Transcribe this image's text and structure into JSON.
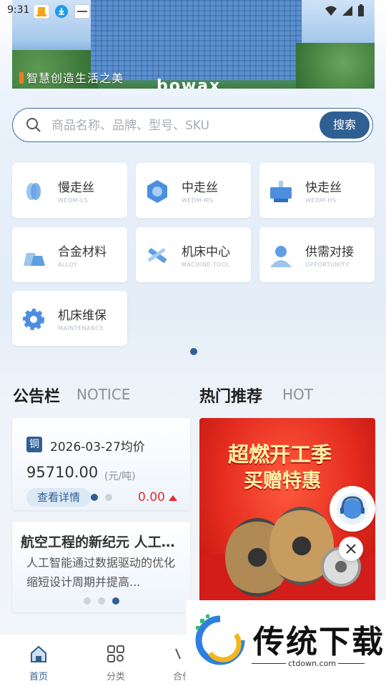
{
  "status_bar": {
    "time": "9:31",
    "app_icons": [
      "bowax-app-icon",
      "download-icon",
      "news-app-icon"
    ],
    "system_icons": [
      "wifi-icon",
      "signal-icon",
      "battery-icon"
    ]
  },
  "banner": {
    "slogan": "智慧创造生活之美",
    "logo_text": "bowax"
  },
  "search": {
    "placeholder": "商品名称、品牌、型号、SKU",
    "value": "",
    "button_label": "搜索"
  },
  "categories": [
    {
      "title": "慢走丝",
      "subtitle": "WEDM-LS",
      "icon": "wire-spool-icon"
    },
    {
      "title": "中走丝",
      "subtitle": "WEDM-MS",
      "icon": "hexagon-nut-icon"
    },
    {
      "title": "快走丝",
      "subtitle": "WEDM-HS",
      "icon": "machine-icon"
    },
    {
      "title": "合金材料",
      "subtitle": "ALLOY",
      "icon": "alloy-icon"
    },
    {
      "title": "机床中心",
      "subtitle": "MACHINE TOOL",
      "icon": "tools-icon"
    },
    {
      "title": "供需对接",
      "subtitle": "OPPORTUNITY",
      "icon": "person-icon"
    },
    {
      "title": "机床维保",
      "subtitle": "MAINTENANCE",
      "icon": "gear-icon"
    }
  ],
  "notice": {
    "title": "公告栏",
    "subtitle": "NOTICE",
    "price_card": {
      "metal": "铜",
      "date": "2026-03-27均价",
      "price": "95710.00",
      "unit": "(元/吨)",
      "detail_label": "查看详情",
      "change": "0.00"
    },
    "article": {
      "headline": "航空工程的新纪元 人工智能...",
      "body": "人工智能通过数据驱动的优化缩短设计周期并提高..."
    }
  },
  "hot": {
    "title": "热门推荐",
    "subtitle": "HOT",
    "promo_line1": "超燃开工季",
    "promo_line2": "买赠特惠"
  },
  "tabbar": {
    "items": [
      {
        "label": "首页",
        "active": true
      },
      {
        "label": "分类",
        "active": false
      },
      {
        "label": "合作",
        "active": false
      }
    ]
  },
  "watermark": {
    "name": "传统下载",
    "url": "ctdown.com"
  },
  "colors": {
    "primary": "#2f5f93",
    "price_red": "#e02d2d",
    "promo_red": "#e42b1f"
  }
}
